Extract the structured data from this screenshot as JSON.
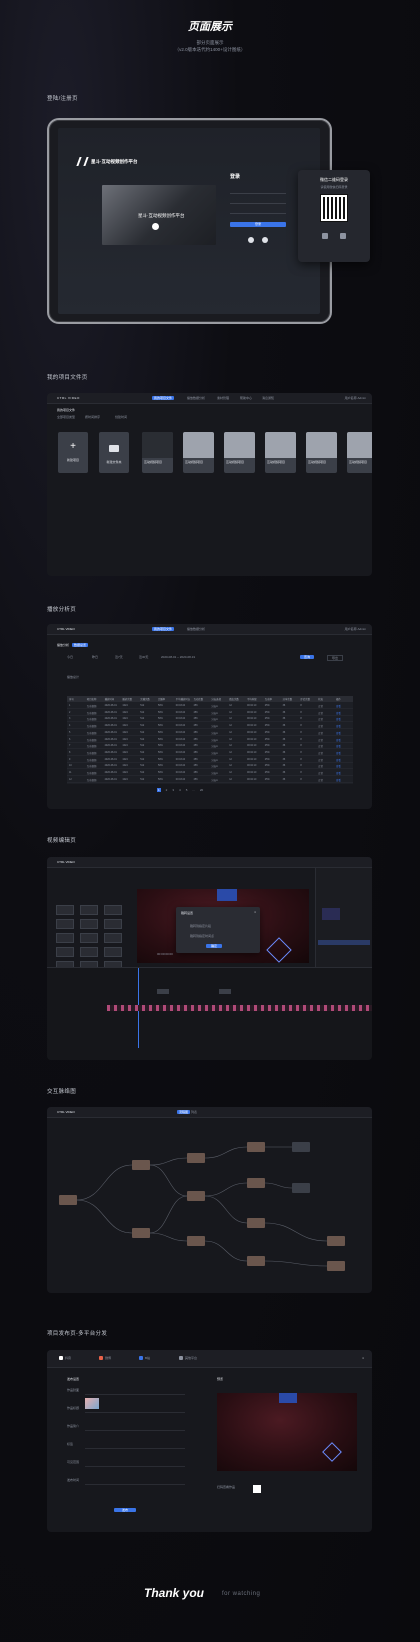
{
  "header": {
    "title": "页面展示",
    "subtitle": "部分页面展示",
    "note": "（v2.0版本迭代约1400+设计图纸）"
  },
  "sections": {
    "login": "登陆/注册页",
    "files": "我的项目文件页",
    "analysis": "播放分析页",
    "editor": "视频编辑页",
    "branch": "交互脉络图",
    "publish": "项目发布页-多平台分发"
  },
  "login": {
    "brand": "星斗·互动视频创作平台",
    "banner_text": "星斗·互动视频创作平台",
    "form_title": "登录",
    "login_button": "登录",
    "qr_title": "微信二维码登录",
    "qr_sub": "请使用微信扫码登录"
  },
  "app": {
    "logo": "CTRL VIDEO",
    "nav": [
      "我的项目文件",
      "播放数据分析",
      "素材管理",
      "帮助中心",
      "消息通知"
    ],
    "user": "用户名称 Admin"
  },
  "files": {
    "breadcrumb": "我的项目文件",
    "filters": [
      "全部项目类型",
      "按时间排序",
      "创建时间"
    ],
    "new_label": "新建项目",
    "folder_label": "新建文件夹",
    "cards": [
      "互动视频项目",
      "互动视频项目",
      "互动视频项目",
      "互动视频项目",
      "互动视频项目",
      "互动视频项目"
    ]
  },
  "analysis": {
    "tabs": [
      "播放分析",
      "数据总览"
    ],
    "filters": [
      "今日",
      "昨日",
      "近7天",
      "近30天",
      "2020-08-01 ~ 2020-08-31"
    ],
    "search_button": "查询",
    "export_button": "导出",
    "summary": "播放总计",
    "columns": [
      "序号",
      "项目名称",
      "播放时间",
      "播放次数",
      "完播次数",
      "完播率",
      "平均播放时长",
      "互动次数",
      "分支选择",
      "跳出次数",
      "平均停留",
      "互动率",
      "分享次数",
      "评论次数",
      "状态",
      "操作"
    ],
    "row_values": [
      "互动视频",
      "2020-08-01",
      "1024",
      "512",
      "50%",
      "00:03:24",
      "256",
      "分支A",
      "12",
      "00:02:10",
      "25%",
      "36",
      "8",
      "正常",
      "查看"
    ],
    "row_count": 12,
    "pagination": [
      "1",
      "2",
      "3",
      "4",
      "5",
      "...",
      "20"
    ]
  },
  "editor": {
    "dialog_title": "跳转设置",
    "dialog_options": [
      "跳转到指定片段",
      "跳转到指定时间点"
    ],
    "dialog_confirm": "确定",
    "timecode": "00:00:00:00"
  },
  "branch": {
    "tabs": [
      "流程图",
      "列表"
    ]
  },
  "publish": {
    "platforms": [
      "抖音",
      "微博",
      "B站",
      "其他平台"
    ],
    "section_label": "发布设置",
    "field_labels": [
      "作品封面",
      "作品标题",
      "作品简介",
      "标签",
      "可见范围",
      "发布时间"
    ],
    "preview_label": "预览",
    "publish_button": "发布",
    "qr_hint": "扫码查看作品"
  },
  "footer": {
    "thanks": "Thank you",
    "watching": "for watching"
  },
  "colors": {
    "accent": "#3a74e8",
    "bg": "#0a0a0d",
    "panel": "#17181d"
  }
}
